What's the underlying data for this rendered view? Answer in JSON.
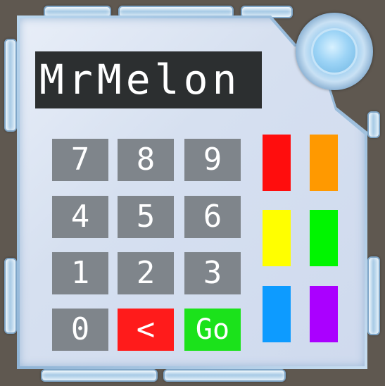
{
  "display": {
    "text": "MrMelon"
  },
  "keypad": {
    "rows": [
      [
        "7",
        "8",
        "9"
      ],
      [
        "4",
        "5",
        "6"
      ],
      [
        "1",
        "2",
        "3"
      ]
    ],
    "zero": "0",
    "back": "<",
    "go": "Go"
  },
  "colors": {
    "key_gray": "#7f858b",
    "back_red": "#ff1b1b",
    "go_green": "#1be21b",
    "display_bg": "#2c2f30"
  },
  "swatches": [
    {
      "name": "red",
      "color": "#ff0d0d"
    },
    {
      "name": "orange",
      "color": "#ff9900"
    },
    {
      "name": "yellow",
      "color": "#ffff00"
    },
    {
      "name": "green",
      "color": "#00f500"
    },
    {
      "name": "blue",
      "color": "#0d9bff"
    },
    {
      "name": "purple",
      "color": "#aa00ff"
    }
  ]
}
